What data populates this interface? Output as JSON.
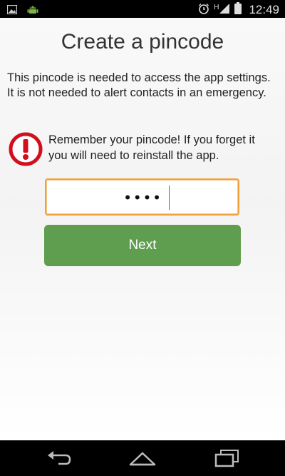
{
  "status_bar": {
    "left_icons": [
      "image-icon",
      "android-icon"
    ],
    "right_icons": [
      "alarm-icon",
      "network-h-icon",
      "signal-icon",
      "battery-icon"
    ],
    "network_label": "H",
    "time": "12:49"
  },
  "screen": {
    "title": "Create a pincode",
    "intro": "This pincode is needed to access the app settings. It is not needed to alert contacts in an emergency.",
    "warning": "Remember your pincode! If you forget it you will need to reinstall the app.",
    "warning_icon": "alert-icon",
    "pin_value": "••••",
    "next_label": "Next"
  },
  "nav_bar": {
    "icons": [
      "back-icon",
      "home-icon",
      "recents-icon"
    ]
  },
  "colors": {
    "accent_orange": "#f0a13a",
    "button_green": "#5f9d4f",
    "warning_red": "#d10f1d"
  }
}
